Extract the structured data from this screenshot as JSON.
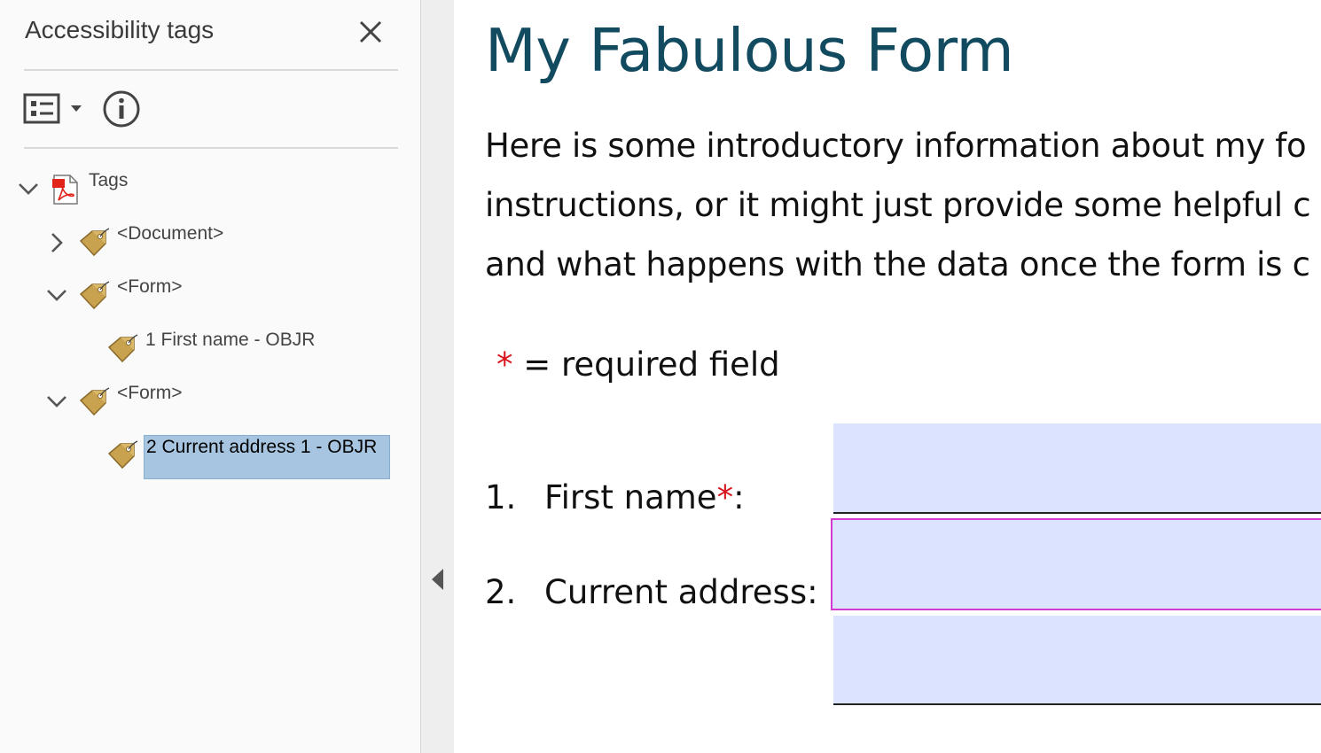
{
  "panel": {
    "title": "Accessibility tags",
    "close_icon": "close-icon",
    "options_icon": "list-options-icon",
    "info_icon": "info-icon",
    "tree": {
      "root_label": "Tags",
      "document_label": "<Document>",
      "form1_label": "<Form>",
      "field1_label": "1 First name - OBJR",
      "form2_label": "<Form>",
      "field2_label": "2 Current address 1 - OBJR"
    }
  },
  "document": {
    "title": "My Fabulous Form",
    "intro_lines": [
      "Here is some introductory information about my fo",
      "instructions, or it might just provide some helpful c",
      "and what happens with the data once the form is c"
    ],
    "required_star": "*",
    "required_text": " = required field",
    "questions": [
      {
        "number": "1.",
        "label": "First name",
        "required_star": "*",
        "suffix": ":"
      },
      {
        "number": "2.",
        "label": "Current address:"
      }
    ]
  },
  "colors": {
    "title": "#124a60",
    "required": "#d9151f",
    "field_bg": "#dce3ff",
    "focus_outline": "#d33bd0",
    "selection": "#a7c5e0"
  }
}
